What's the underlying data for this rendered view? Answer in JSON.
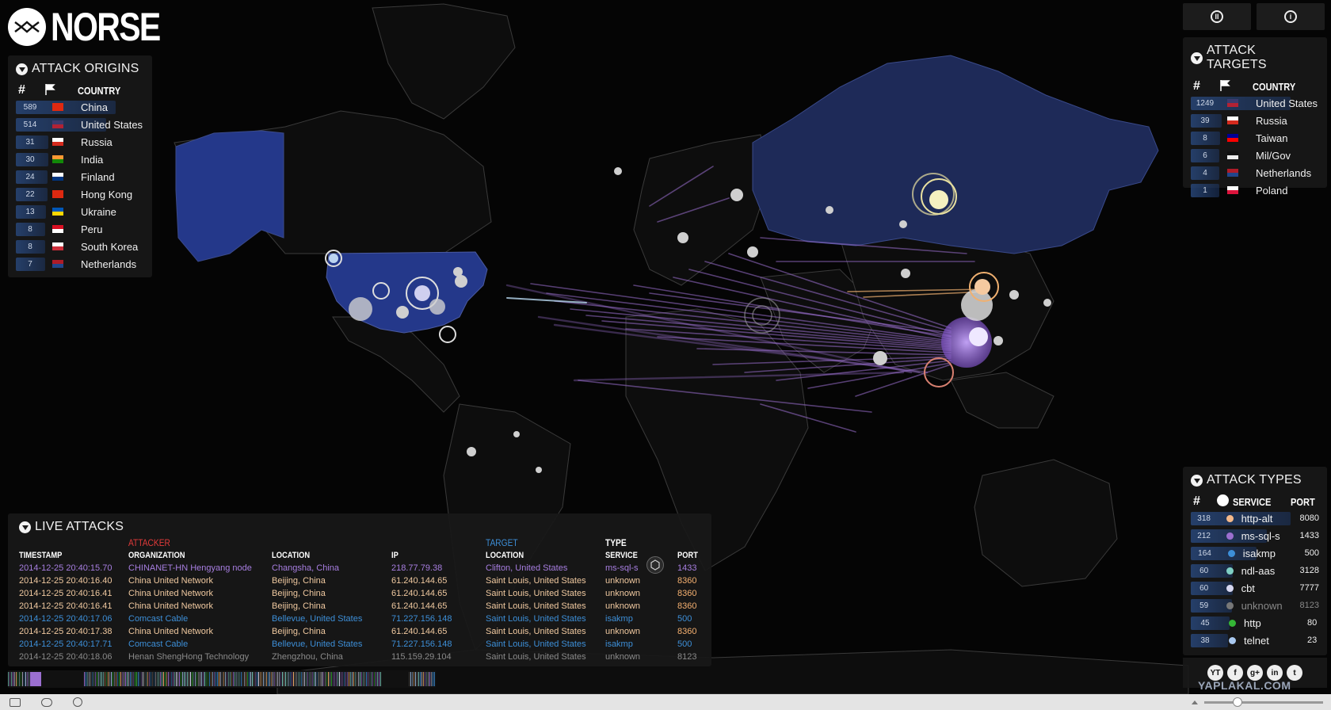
{
  "brand": "NORSE",
  "origins": {
    "title": "ATTACK ORIGINS",
    "col_num": "#",
    "col_country": "COUNTRY",
    "rows": [
      {
        "count": "589",
        "country": "China",
        "flag": [
          "#de2910",
          "#de2910"
        ],
        "frac": 1.0
      },
      {
        "count": "514",
        "country": "United States",
        "flag": [
          "#3c3b6e",
          "#b22234"
        ],
        "frac": 0.87
      },
      {
        "count": "31",
        "country": "Russia",
        "flag": [
          "#ffffff",
          "#d52b1e"
        ],
        "frac": 0.06
      },
      {
        "count": "30",
        "country": "India",
        "flag": [
          "#ff9933",
          "#138808"
        ],
        "frac": 0.05
      },
      {
        "count": "24",
        "country": "Finland",
        "flag": [
          "#ffffff",
          "#003580"
        ],
        "frac": 0.04
      },
      {
        "count": "22",
        "country": "Hong Kong",
        "flag": [
          "#de2910",
          "#de2910"
        ],
        "frac": 0.04
      },
      {
        "count": "13",
        "country": "Ukraine",
        "flag": [
          "#0057b7",
          "#ffd700"
        ],
        "frac": 0.02
      },
      {
        "count": "8",
        "country": "Peru",
        "flag": [
          "#d91023",
          "#ffffff"
        ],
        "frac": 0.01
      },
      {
        "count": "8",
        "country": "South Korea",
        "flag": [
          "#ffffff",
          "#cd2e3a"
        ],
        "frac": 0.01
      },
      {
        "count": "7",
        "country": "Netherlands",
        "flag": [
          "#ae1c28",
          "#21468b"
        ],
        "frac": 0.01
      }
    ]
  },
  "targets": {
    "title": "ATTACK TARGETS",
    "col_num": "#",
    "col_country": "COUNTRY",
    "rows": [
      {
        "count": "1249",
        "country": "United States",
        "flag": [
          "#3c3b6e",
          "#b22234"
        ],
        "frac": 1.0
      },
      {
        "count": "39",
        "country": "Russia",
        "flag": [
          "#ffffff",
          "#d52b1e"
        ],
        "frac": 0.03
      },
      {
        "count": "8",
        "country": "Taiwan",
        "flag": [
          "#000095",
          "#fe0000"
        ],
        "frac": 0.01
      },
      {
        "count": "6",
        "country": "Mil/Gov",
        "flag": [
          "#111111",
          "#eeeeee"
        ],
        "frac": 0.005
      },
      {
        "count": "4",
        "country": "Netherlands",
        "flag": [
          "#ae1c28",
          "#21468b"
        ],
        "frac": 0.003
      },
      {
        "count": "1",
        "country": "Poland",
        "flag": [
          "#ffffff",
          "#dc143c"
        ],
        "frac": 0.001
      }
    ]
  },
  "types": {
    "title": "ATTACK TYPES",
    "col_num": "#",
    "col_service": "SERVICE",
    "col_port": "PORT",
    "rows": [
      {
        "count": "318",
        "service": "http-alt",
        "port": "8080",
        "color": "#f5b98a",
        "frac": 1.0
      },
      {
        "count": "212",
        "service": "ms-sql-s",
        "port": "1433",
        "color": "#9b6fd0",
        "frac": 0.67
      },
      {
        "count": "164",
        "service": "isakmp",
        "port": "500",
        "color": "#3d8fd8",
        "frac": 0.52
      },
      {
        "count": "60",
        "service": "ndl-aas",
        "port": "3128",
        "color": "#7fcfc4",
        "frac": 0.19
      },
      {
        "count": "60",
        "service": "cbt",
        "port": "7777",
        "color": "#d7d7f0",
        "frac": 0.19
      },
      {
        "count": "59",
        "service": "unknown",
        "port": "8123",
        "color": "#777777",
        "frac": 0.18
      },
      {
        "count": "45",
        "service": "http",
        "port": "80",
        "color": "#35b535",
        "frac": 0.14
      },
      {
        "count": "38",
        "service": "telnet",
        "port": "23",
        "color": "#a9c8ef",
        "frac": 0.12
      }
    ]
  },
  "live": {
    "title": "LIVE ATTACKS",
    "attacker": "ATTACKER",
    "target": "TARGET",
    "type": "TYPE",
    "headers": {
      "timestamp": "TIMESTAMP",
      "organization": "ORGANIZATION",
      "location": "LOCATION",
      "ip": "IP",
      "tlocation": "LOCATION",
      "service": "SERVICE",
      "port": "PORT"
    },
    "rows": [
      {
        "ts": "2014-12-25   20:40:15.70",
        "org": "CHINANET-HN Hengyang node",
        "loc": "Changsha, China",
        "ip": "218.77.79.38",
        "tloc": "Clifton, United States",
        "svc": "ms-sql-s",
        "port": "1433",
        "color": "#a77ee0"
      },
      {
        "ts": "2014-12-25   20:40:16.40",
        "org": "China United Network",
        "loc": "Beijing, China",
        "ip": "61.240.144.65",
        "tloc": "Saint Louis, United States",
        "svc": "unknown",
        "port": "8360",
        "color": "#f0c9a0"
      },
      {
        "ts": "2014-12-25   20:40:16.41",
        "org": "China United Network",
        "loc": "Beijing, China",
        "ip": "61.240.144.65",
        "tloc": "Saint Louis, United States",
        "svc": "unknown",
        "port": "8360",
        "color": "#f0c9a0"
      },
      {
        "ts": "2014-12-25   20:40:16.41",
        "org": "China United Network",
        "loc": "Beijing, China",
        "ip": "61.240.144.65",
        "tloc": "Saint Louis, United States",
        "svc": "unknown",
        "port": "8360",
        "color": "#f0c9a0"
      },
      {
        "ts": "2014-12-25   20:40:17.06",
        "org": "Comcast Cable",
        "loc": "Bellevue, United States",
        "ip": "71.227.156.148",
        "tloc": "Saint Louis, United States",
        "svc": "isakmp",
        "port": "500",
        "color": "#3d8fd8"
      },
      {
        "ts": "2014-12-25   20:40:17.38",
        "org": "China United Network",
        "loc": "Beijing, China",
        "ip": "61.240.144.65",
        "tloc": "Saint Louis, United States",
        "svc": "unknown",
        "port": "8360",
        "color": "#f0c9a0"
      },
      {
        "ts": "2014-12-25   20:40:17.71",
        "org": "Comcast Cable",
        "loc": "Bellevue, United States",
        "ip": "71.227.156.148",
        "tloc": "Saint Louis, United States",
        "svc": "isakmp",
        "port": "500",
        "color": "#3d8fd8"
      },
      {
        "ts": "2014-12-25   20:40:18.06",
        "org": "Henan ShengHong Technology",
        "loc": "Zhengzhou, China",
        "ip": "115.159.29.104",
        "tloc": "Saint Louis, United States",
        "svc": "unknown",
        "port": "8123",
        "color": "#8a8a8a"
      }
    ]
  },
  "social": [
    "YT",
    "f",
    "g+",
    "in",
    "t"
  ],
  "watermark": "YAPLAKAL.COM",
  "colors": {
    "map_highlight": "#24388a",
    "land_dark": "#0b0b0b",
    "attack_purple": "#9b6fd0",
    "attack_orange": "#f0b070",
    "attacker_red": "#e23a3a",
    "target_blue": "#3d8fd8"
  }
}
